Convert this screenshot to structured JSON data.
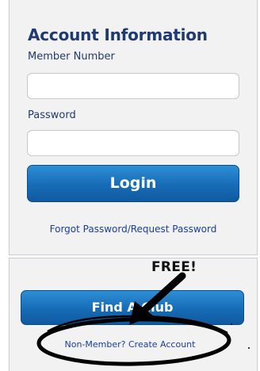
{
  "account": {
    "title": "Account Information",
    "member_number_label": "Member Number",
    "member_number_value": "",
    "password_label": "Password",
    "password_value": "",
    "login_label": "Login",
    "forgot_link": "Forgot Password/Request Password"
  },
  "promo": {
    "annotation_text": "FREE!",
    "find_button_label": "Find A Club",
    "create_account_link": "Non-Member? Create Account"
  },
  "colors": {
    "heading": "#1f3a73",
    "link": "#1a3ea6",
    "button_top": "#2d8fd6",
    "button_bottom": "#0f5aa0",
    "panel_bg": "#f2f2f2"
  }
}
